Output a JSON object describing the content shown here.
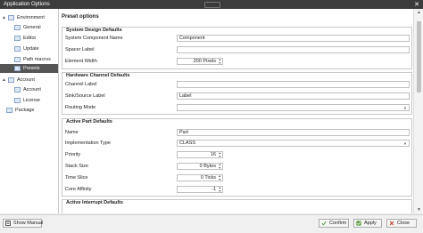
{
  "window": {
    "title": "Application Options"
  },
  "sidebar": {
    "items": [
      {
        "label": "Environment",
        "expand": "▲"
      },
      {
        "label": "General"
      },
      {
        "label": "Editor"
      },
      {
        "label": "Update"
      },
      {
        "label": "Path macros"
      },
      {
        "label": "Presets"
      },
      {
        "label": "Account",
        "expand": "▲"
      },
      {
        "label": "Account"
      },
      {
        "label": "License"
      },
      {
        "label": "Package"
      }
    ]
  },
  "content": {
    "header": "Preset options",
    "groups": {
      "system_design": {
        "title": "System Design Defaults",
        "component_name": {
          "label": "System Component Name",
          "value": "Component"
        },
        "spacer_label": {
          "label": "Spacer Label",
          "value": ""
        },
        "element_width": {
          "label": "Element Width",
          "value": "200 Pixels"
        }
      },
      "hardware_channel": {
        "title": "Hardware Channel Defaults",
        "channel_label": {
          "label": "Channel Label",
          "value": ""
        },
        "sink_source_label": {
          "label": "Sink/Source Label",
          "value": "Label"
        },
        "routing_mode": {
          "label": "Routing Mode",
          "value": ""
        }
      },
      "active_part": {
        "title": "Active Part Defaults",
        "name": {
          "label": "Name",
          "value": "Part"
        },
        "implementation_type": {
          "label": "Implementation Type",
          "value": "CLASS"
        },
        "priority": {
          "label": "Priority",
          "value": "16"
        },
        "stack_size": {
          "label": "Stack Size",
          "value": "0 Bytes"
        },
        "time_slice": {
          "label": "Time Slice",
          "value": "0 Ticks"
        },
        "core_affinity": {
          "label": "Core Affinity",
          "value": "-1"
        }
      },
      "active_interrupt": {
        "title": "Active Interrupt Defaults"
      }
    }
  },
  "footer": {
    "show_manual": "Show Manual",
    "confirm": "Confirm",
    "apply": "Apply",
    "close": "Close"
  },
  "colors": {
    "accent": "#5a9e3a",
    "selected": "#555555",
    "titlebar": "#3c3c3c"
  }
}
